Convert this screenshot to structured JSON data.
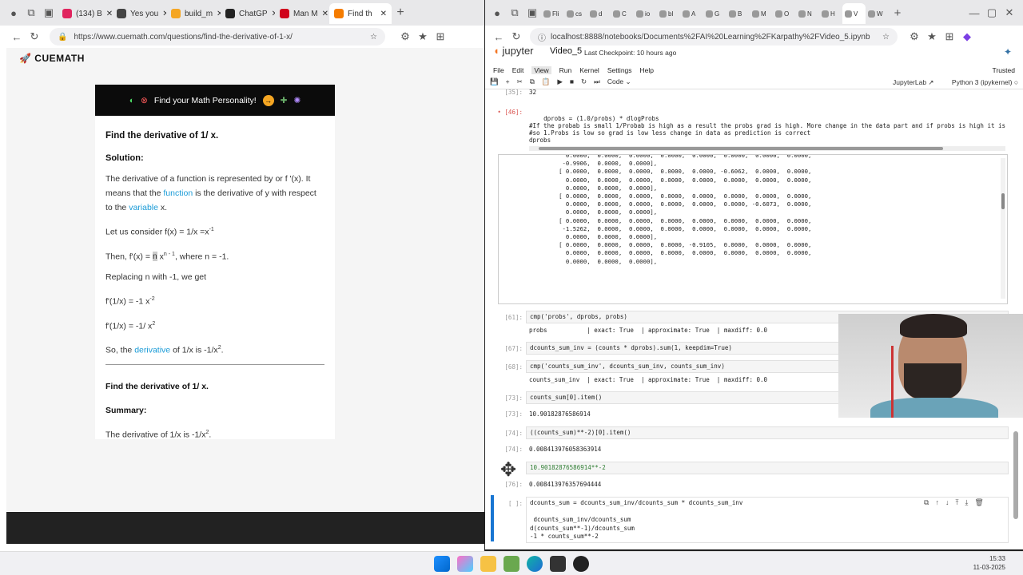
{
  "left_browser": {
    "tabs": [
      {
        "label": "(134) B",
        "color": "#e0245e"
      },
      {
        "label": "Yes you",
        "color": "#444444"
      },
      {
        "label": "build_m",
        "color": "#f5a623"
      },
      {
        "label": "ChatGP",
        "color": "#222222"
      },
      {
        "label": "Man M",
        "color": "#d0021b"
      },
      {
        "label": "Find th",
        "color": "#f57c00"
      }
    ],
    "url": "https://www.cuemath.com/questions/find-the-derivative-of-1-x/",
    "logo": "CUEMATH",
    "banner": "Find your Math Personality!",
    "title": "Find the derivative of 1/ x.",
    "solution_heading": "Solution:",
    "p1_a": "The derivative of a function is represented by or f '(x). It means that the ",
    "p1_link1": "function",
    "p1_b": " is the derivative of y with respect to the ",
    "p1_link2": "variable",
    "p1_c": " x.",
    "line1_a": "Let us consider f(x) = 1/x =x",
    "line1_sup": "-1",
    "line2_a": "Then, f'(x) = ",
    "line2_n": "n",
    "line2_b": " x",
    "line2_sup": "n - 1",
    "line2_c": ", where n = -1.",
    "line3": "Replacing n with -1, we get",
    "line4_a": "f'(1/x) = -1 x",
    "line4_sup": "-2",
    "line5_a": "f'(1/x) = -1/ x",
    "line5_sup": "2",
    "line6_a": "So, the ",
    "line6_link": "derivative",
    "line6_b": " of 1/x is -1/x",
    "line6_sup": "2",
    "line6_c": ".",
    "find_title": "Find the derivative of 1/ x.",
    "summary_heading": "Summary:",
    "summary_a": "The derivative of 1/x is -1/x",
    "summary_sup": "2",
    "summary_c": "."
  },
  "right_browser": {
    "tabs": [
      "Fli",
      "cs",
      "d",
      "C",
      "io",
      "bl",
      "A",
      "G",
      "B",
      "M",
      "O",
      "N",
      "H",
      "V",
      "W"
    ],
    "url": "localhost:8888/notebooks/Documents%2FAI%20Learning%2FKarpathy%2FVideo_5.ipynb",
    "jupyter_label": "jupyter",
    "notebook_name": "Video_5",
    "checkpoint": "Last Checkpoint: 10 hours ago",
    "menu": [
      "File",
      "Edit",
      "View",
      "Run",
      "Kernel",
      "Settings",
      "Help"
    ],
    "trusted": "Trusted",
    "cell_type": "Code",
    "jupyterlab": "JupyterLab",
    "kernel": "Python 3 (ipykernel)"
  },
  "cells": {
    "c35_prompt": "[35]:",
    "c35_out": "32",
    "c46_prompt": "[46]:",
    "c46_code": "dprobs = (1.0/probs) * dlogProbs\n#If the probab is small 1/Probab is high as a result the probs grad is high. More change in the data part and if probs is high it is making\n#so 1.Probs is low so grad is low less change in data as prediction is correct\ndprobs",
    "tensor_out": "          0.0000,  0.0000,  0.0000,  0.0000,  0.0000,  0.0000,  0.0000,  0.0000,\n         -0.9906,  0.0000,  0.0000],\n        [ 0.0000,  0.0000,  0.0000,  0.0000,  0.0000, -0.6062,  0.0000,  0.0000,\n          0.0000,  0.0000,  0.0000,  0.0000,  0.0000,  0.0000,  0.0000,  0.0000,\n          0.0000,  0.0000,  0.0000],\n        [ 0.0000,  0.0000,  0.0000,  0.0000,  0.0000,  0.0000,  0.0000,  0.0000,\n          0.0000,  0.0000,  0.0000,  0.0000,  0.0000,  0.0000, -0.6073,  0.0000,\n          0.0000,  0.0000,  0.0000],\n        [ 0.0000,  0.0000,  0.0000,  0.0000,  0.0000,  0.0000,  0.0000,  0.0000,\n         -1.5262,  0.0000,  0.0000,  0.0000,  0.0000,  0.0000,  0.0000,  0.0000,\n          0.0000,  0.0000,  0.0000],\n        [ 0.0000,  0.0000,  0.0000,  0.0000, -0.9105,  0.0000,  0.0000,  0.0000,\n          0.0000,  0.0000,  0.0000,  0.0000,  0.0000,  0.0000,  0.0000,  0.0000,\n          0.0000,  0.0000,  0.0000],",
    "c61_prompt": "[61]:",
    "c61_code": "cmp('probs', dprobs, probs)",
    "c61_out": "probs           | exact: True  | approximate: True  | maxdiff: 0.0",
    "c67_prompt": "[67]:",
    "c67_code": "dcounts_sum_inv = (counts * dprobs).sum(1, keepdim=True)",
    "c68_prompt": "[68]:",
    "c68_code": "cmp('counts_sum_inv', dcounts_sum_inv, counts_sum_inv)",
    "c68_out": "counts_sum_inv  | exact: True  | approximate: True  | maxdiff: 0.0",
    "c73_prompt": "[73]:",
    "c73_code": "counts_sum[0].item()",
    "c73_out_prompt": "[73]:",
    "c73_out": "10.90182876586914",
    "c74_prompt": "[74]:",
    "c74_code": "((counts_sum)**-2)[0].item()",
    "c74_out_prompt": "[74]:",
    "c74_out": "0.008413976058363914",
    "c76_code": "10.90182876586914**-2",
    "c76_out_prompt": "[76]:",
    "c76_out": "0.008413976357694444",
    "ce_prompt": "[ ]:",
    "ce_code": "dcounts_sum = dcounts_sum_inv/dcounts_sum * dcounts_sum_inv\n\n dcounts_sum_inv/dcounts_sum\nd(counts_sum**-1)/dcounts_sum\n-1 * counts_sum**-2"
  },
  "taskbar": {
    "time": "15:33",
    "date": "11-03-2025"
  },
  "colors": {
    "link": "#1a9bd7",
    "jupyter_orange": "#f37726",
    "active_cell": "#1976d2"
  }
}
